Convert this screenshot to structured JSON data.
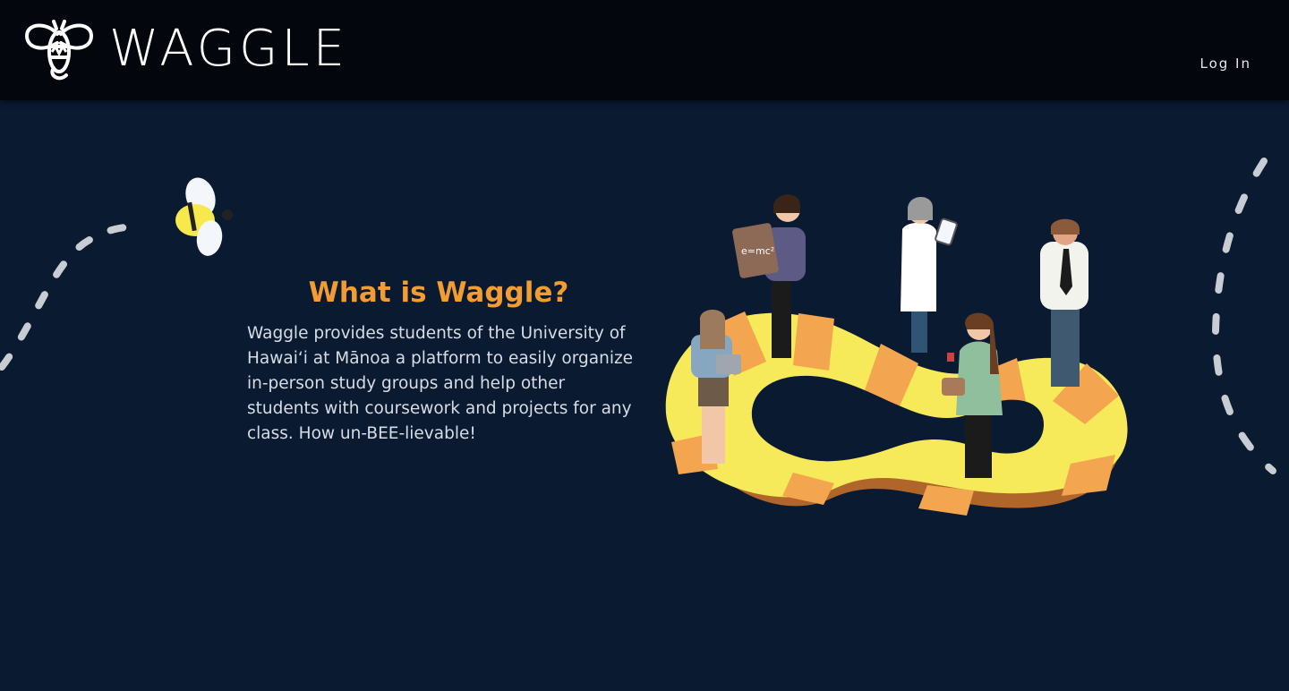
{
  "header": {
    "brand_name": "WAGGLE",
    "logo_icon": "waggle-bee-logo-icon",
    "login_label": "Log In"
  },
  "hero": {
    "title": "What is Waggle?",
    "body": "Waggle provides students of the University of Hawaiʻi at Mānoa a platform to easily organize in-person study groups and help other students with coursework and projects for any class. How un-BEE-lievable!",
    "bee_icon": "bee-icon",
    "illustration": "students-on-infinity-track-illustration",
    "clipboard_text": "e=mc²"
  },
  "colors": {
    "background": "#0a1a31",
    "header_background": "#03060d",
    "accent_orange": "#f39c32",
    "track_yellow": "#f6ea5a",
    "track_orange": "#f3a54f",
    "trail_gray": "#c8ccd3"
  }
}
